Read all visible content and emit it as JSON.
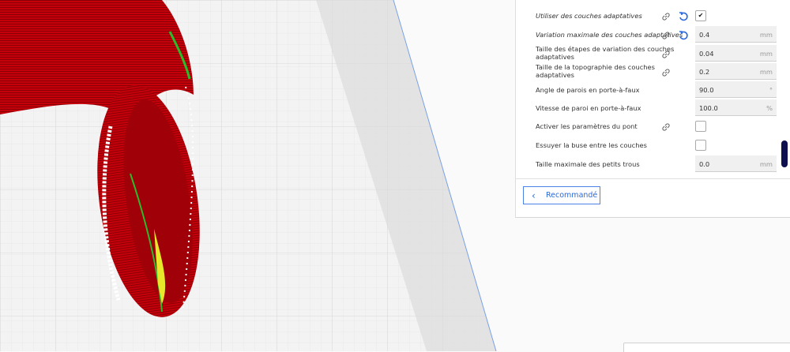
{
  "settings": [
    {
      "label": "Utiliser des couches adaptatives",
      "type": "checkbox",
      "checked": true,
      "link": true,
      "reset": true,
      "italic": true
    },
    {
      "label": "Variation maximale des couches adaptatives",
      "type": "input",
      "value": "0.4",
      "unit": "mm",
      "link": true,
      "reset": true,
      "italic": true
    },
    {
      "label": "Taille des étapes de variation des couches adaptatives",
      "type": "input",
      "value": "0.04",
      "unit": "mm",
      "link": true
    },
    {
      "label": "Taille de la topographie des couches adaptatives",
      "type": "input",
      "value": "0.2",
      "unit": "mm",
      "link": true
    },
    {
      "label": "Angle de parois en porte-à-faux",
      "type": "input",
      "value": "90.0",
      "unit": "°"
    },
    {
      "label": "Vitesse de paroi en porte-à-faux",
      "type": "input",
      "value": "100.0",
      "unit": "%"
    },
    {
      "label": "Activer les paramètres du pont",
      "type": "checkbox",
      "checked": false,
      "link": true
    },
    {
      "label": "Essuyer la buse entre les couches",
      "type": "checkbox",
      "checked": false
    },
    {
      "label": "Taille maximale des petits trous",
      "type": "input",
      "value": "0.0",
      "unit": "mm"
    }
  ],
  "recommended_button": {
    "label": "Recommandé",
    "icon": "chevron-left-icon"
  },
  "colors": {
    "accent": "#2a6ad8",
    "model": "#c8000a",
    "scrollbar": "#0d0f4f"
  }
}
